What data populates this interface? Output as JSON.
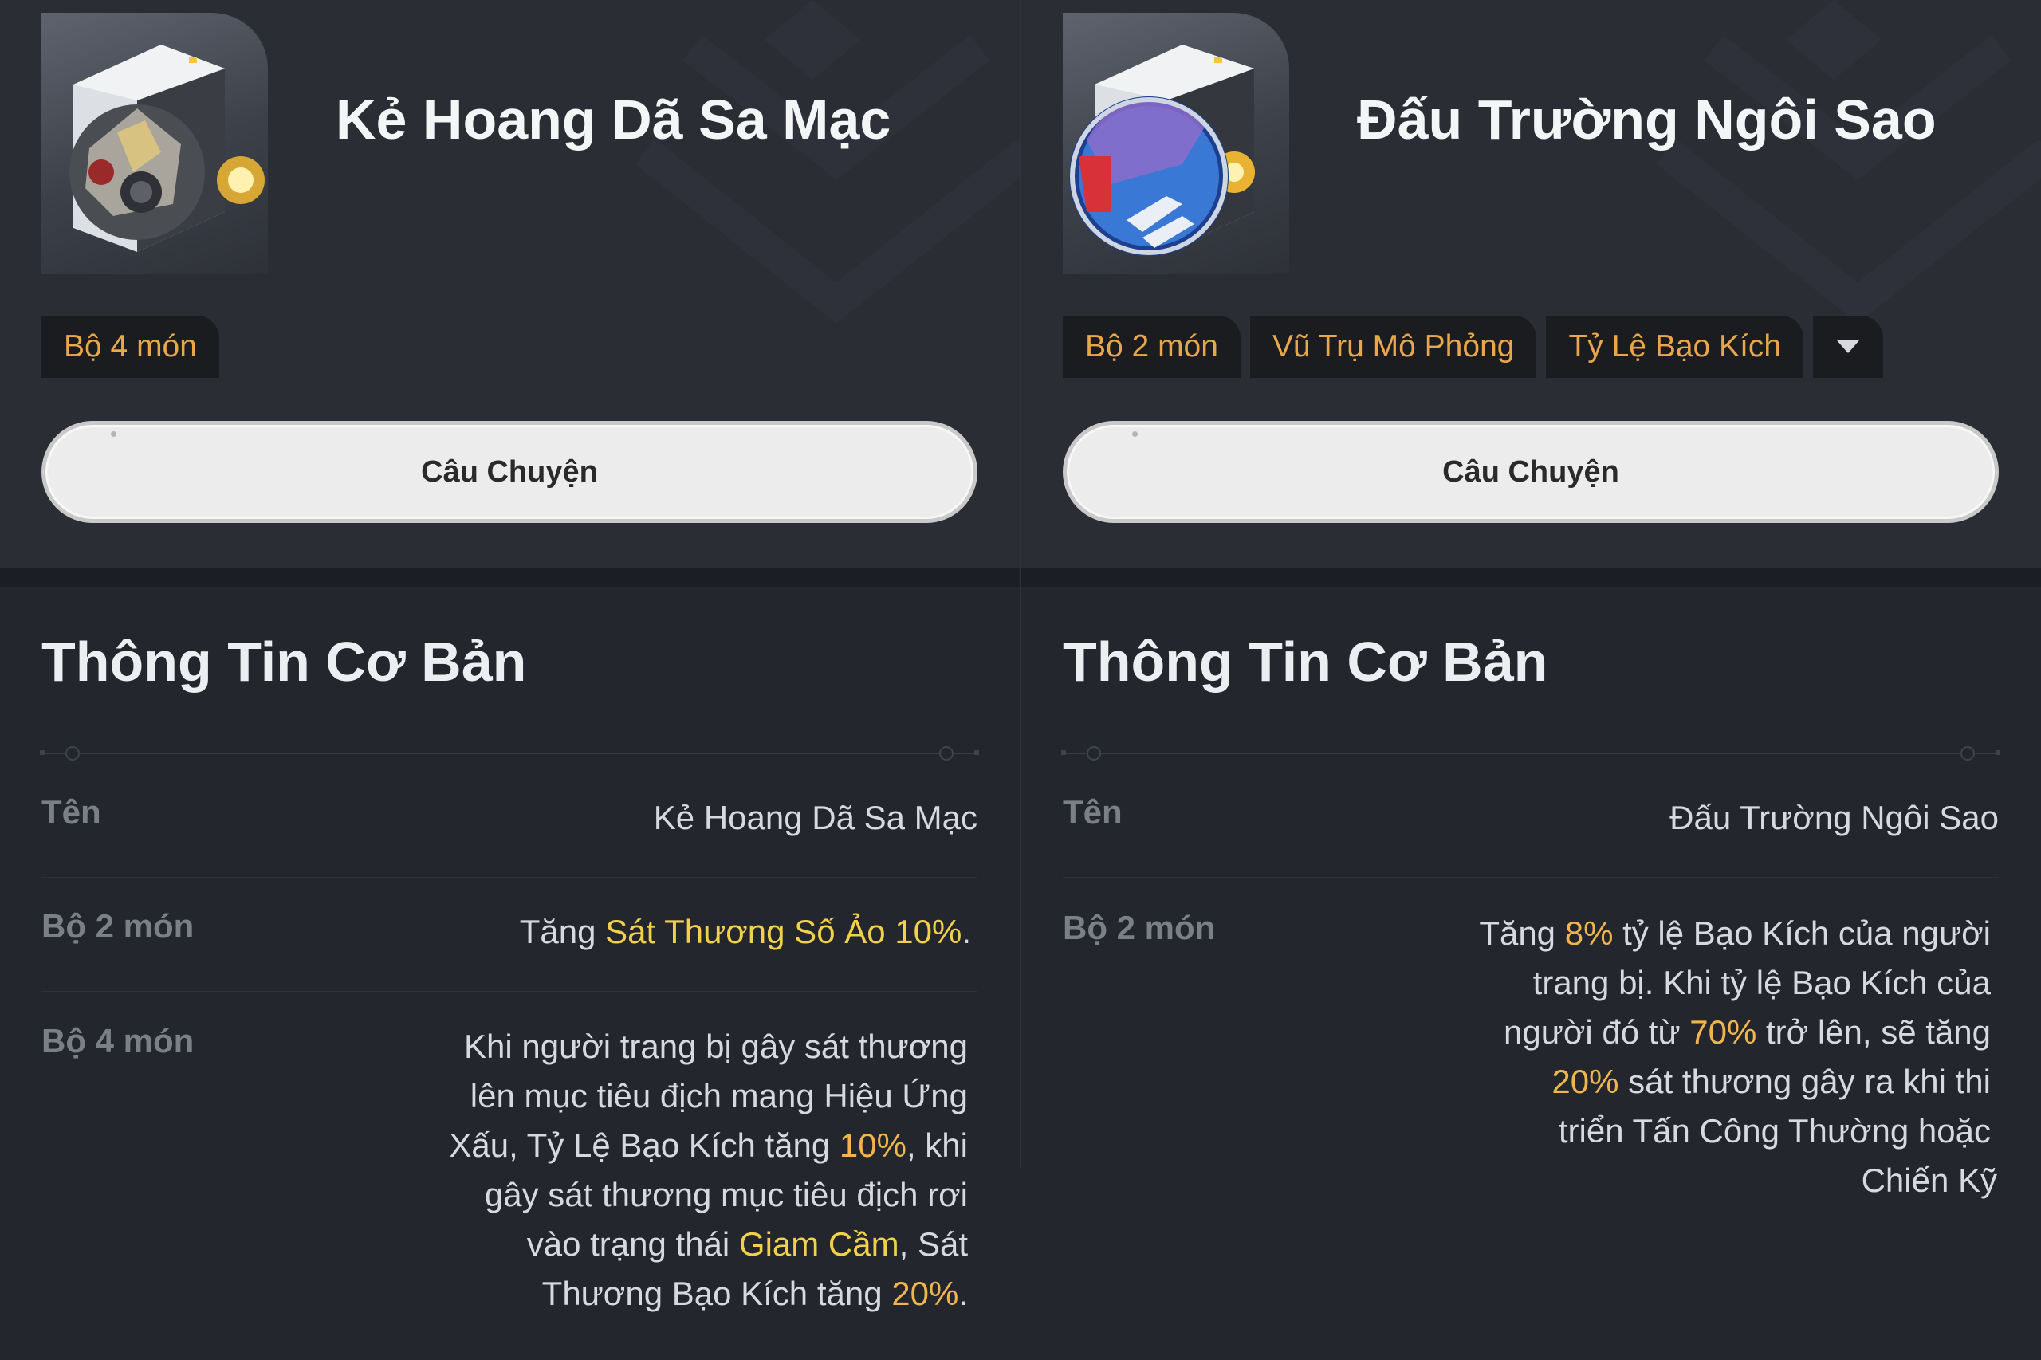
{
  "panels": [
    {
      "title": "Kẻ Hoang Dã Sa Mạc",
      "tags": [
        "Bộ 4 món"
      ],
      "has_dropdown": false,
      "story_button": "Câu Chuyện",
      "section_title": "Thông Tin Cơ Bản",
      "rows": [
        {
          "label": "Tên",
          "value": "Kẻ Hoang Dã Sa Mạc"
        },
        {
          "label": "Bộ 2 món",
          "segments": [
            {
              "text": "Tăng ",
              "hl": ""
            },
            {
              "text": "Sát Thương Số Ảo 10%",
              "hl": "y"
            },
            {
              "text": ".",
              "hl": ""
            }
          ]
        },
        {
          "label": "Bộ 4 món",
          "lines": [
            [
              {
                "text": "Khi người trang bị gây sát thương",
                "hl": ""
              }
            ],
            [
              {
                "text": "lên mục tiêu địch mang Hiệu Ứng",
                "hl": ""
              }
            ],
            [
              {
                "text": "Xấu, Tỷ Lệ Bạo Kích tăng ",
                "hl": ""
              },
              {
                "text": "10%",
                "hl": "o"
              },
              {
                "text": ", khi",
                "hl": ""
              }
            ],
            [
              {
                "text": "gây sát thương mục tiêu địch rơi",
                "hl": ""
              }
            ],
            [
              {
                "text": "vào trạng thái ",
                "hl": ""
              },
              {
                "text": "Giam Cầm",
                "hl": "y"
              },
              {
                "text": ", Sát",
                "hl": ""
              }
            ],
            [
              {
                "text": "Thương Bạo Kích tăng ",
                "hl": ""
              },
              {
                "text": "20%",
                "hl": "o"
              },
              {
                "text": ".",
                "hl": ""
              }
            ]
          ]
        }
      ]
    },
    {
      "title": "Đấu Trường Ngôi Sao",
      "tags": [
        "Bộ 2 món",
        "Vũ Trụ Mô Phỏng",
        "Tỷ Lệ Bạo Kích"
      ],
      "has_dropdown": true,
      "story_button": "Câu Chuyện",
      "section_title": "Thông Tin Cơ Bản",
      "rows": [
        {
          "label": "Tên",
          "value": "Đấu Trường Ngôi Sao"
        },
        {
          "label": "Bộ 2 món",
          "lines": [
            [
              {
                "text": "Tăng ",
                "hl": ""
              },
              {
                "text": "8%",
                "hl": "o"
              },
              {
                "text": " tỷ lệ Bạo Kích của người",
                "hl": ""
              }
            ],
            [
              {
                "text": "trang bị. Khi tỷ lệ Bạo Kích của",
                "hl": ""
              }
            ],
            [
              {
                "text": "người đó từ ",
                "hl": ""
              },
              {
                "text": "70%",
                "hl": "o"
              },
              {
                "text": " trở lên, sẽ tăng",
                "hl": ""
              }
            ],
            [
              {
                "text": "20%",
                "hl": "o"
              },
              {
                "text": " sát thương gây ra khi thi",
                "hl": ""
              }
            ],
            [
              {
                "text": "triển Tấn Công Thường hoặc",
                "hl": ""
              }
            ],
            [
              {
                "text": "Chiến Kỹ",
                "hl": ""
              }
            ]
          ]
        }
      ]
    }
  ],
  "colors": {
    "highlight_yellow": "#f2d14a",
    "highlight_orange": "#f0b54d",
    "tag_text": "#e9a64a"
  }
}
